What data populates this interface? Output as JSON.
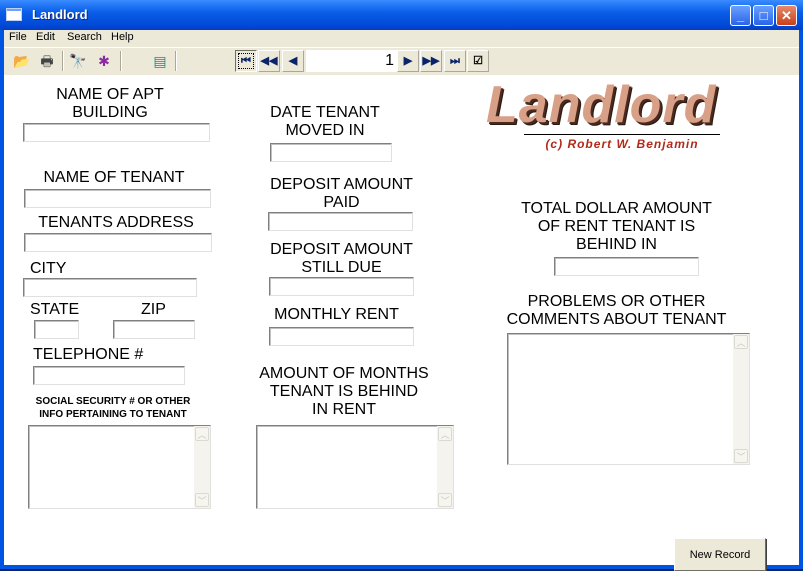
{
  "window": {
    "title": "Landlord",
    "controls": {
      "minimize": "_",
      "maximize": "□",
      "close": "✕"
    }
  },
  "menu": [
    "File",
    "Edit",
    "Search",
    "Help"
  ],
  "toolbar": {
    "icons": {
      "open": "📂",
      "print": "🖶",
      "find": "🔭",
      "debug": "✱",
      "calculator": "▤",
      "properties": "☑"
    },
    "nav": {
      "first": "⏮",
      "prev_page": "◀◀",
      "prev": "◀",
      "record_number": "1",
      "next": "▶",
      "next_page": "▶▶",
      "last": "⏭"
    }
  },
  "logo": {
    "title": "Landlord",
    "subtitle": "(c) Robert W. Benjamin"
  },
  "form": {
    "apt_building": {
      "label": "NAME OF APT\nBUILDING",
      "value": ""
    },
    "tenant_name": {
      "label": "NAME OF TENANT",
      "value": ""
    },
    "tenant_address": {
      "label": "TENANTS ADDRESS",
      "value": ""
    },
    "city": {
      "label": "CITY",
      "value": ""
    },
    "state": {
      "label": "STATE",
      "value": ""
    },
    "zip": {
      "label": "ZIP",
      "value": ""
    },
    "telephone": {
      "label": "TELEPHONE #",
      "value": ""
    },
    "ssn_info": {
      "label": "SOCIAL SECURITY # OR OTHER\nINFO PERTAINING TO TENANT",
      "value": ""
    },
    "date_moved_in": {
      "label": "DATE TENANT\nMOVED IN",
      "value": ""
    },
    "deposit_paid": {
      "label": "DEPOSIT AMOUNT\nPAID",
      "value": ""
    },
    "deposit_due": {
      "label": "DEPOSIT AMOUNT\nSTILL DUE",
      "value": ""
    },
    "monthly_rent": {
      "label": "MONTHLY RENT",
      "value": ""
    },
    "months_behind": {
      "label": "AMOUNT OF MONTHS\nTENANT IS BEHIND\nIN RENT",
      "value": ""
    },
    "total_behind": {
      "label": "TOTAL DOLLAR AMOUNT\nOF RENT TENANT IS\nBEHIND IN",
      "value": ""
    },
    "comments": {
      "label": "PROBLEMS OR OTHER\nCOMMENTS ABOUT TENANT",
      "value": ""
    }
  },
  "buttons": {
    "new_record": "New Record"
  },
  "scroll": {
    "up": "︿",
    "down": "﹀"
  }
}
